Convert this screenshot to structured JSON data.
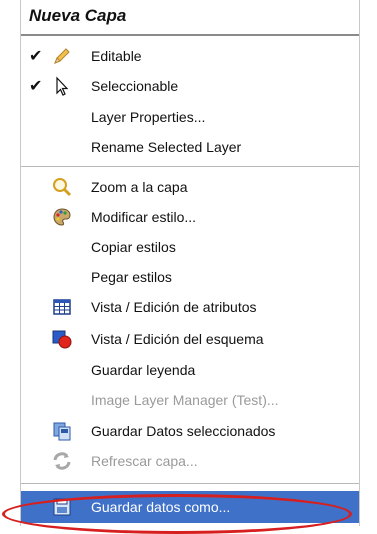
{
  "menu": {
    "title": "Nueva Capa",
    "items": [
      {
        "label": "Editable",
        "check": "✔"
      },
      {
        "label": "Seleccionable",
        "check": "✔"
      },
      {
        "label": "Layer Properties..."
      },
      {
        "label": "Rename Selected Layer"
      },
      {
        "label": "Zoom a la capa"
      },
      {
        "label": "Modificar estilo..."
      },
      {
        "label": "Copiar estilos"
      },
      {
        "label": "Pegar estilos"
      },
      {
        "label": "Vista / Edición de atributos"
      },
      {
        "label": "Vista / Edición del esquema"
      },
      {
        "label": "Guardar leyenda"
      },
      {
        "label": "Image Layer Manager (Test)..."
      },
      {
        "label": "Guardar Datos seleccionados"
      },
      {
        "label": "Refrescar capa..."
      },
      {
        "label": "Guardar datos como..."
      }
    ]
  },
  "colors": {
    "selected_bg": "#3f71c9",
    "highlight_oval": "#d71f1f"
  },
  "icons": {
    "editable": "pencil-icon",
    "seleccionable": "cursor-icon",
    "zoom": "magnifier-icon",
    "modificar_estilo": "palette-icon",
    "atributos": "table-icon",
    "esquema": "schema-icon",
    "guardar_datos_seleccionados": "save-selection-icon",
    "refrescar": "refresh-icon",
    "guardar_como": "floppy-disk-icon"
  }
}
